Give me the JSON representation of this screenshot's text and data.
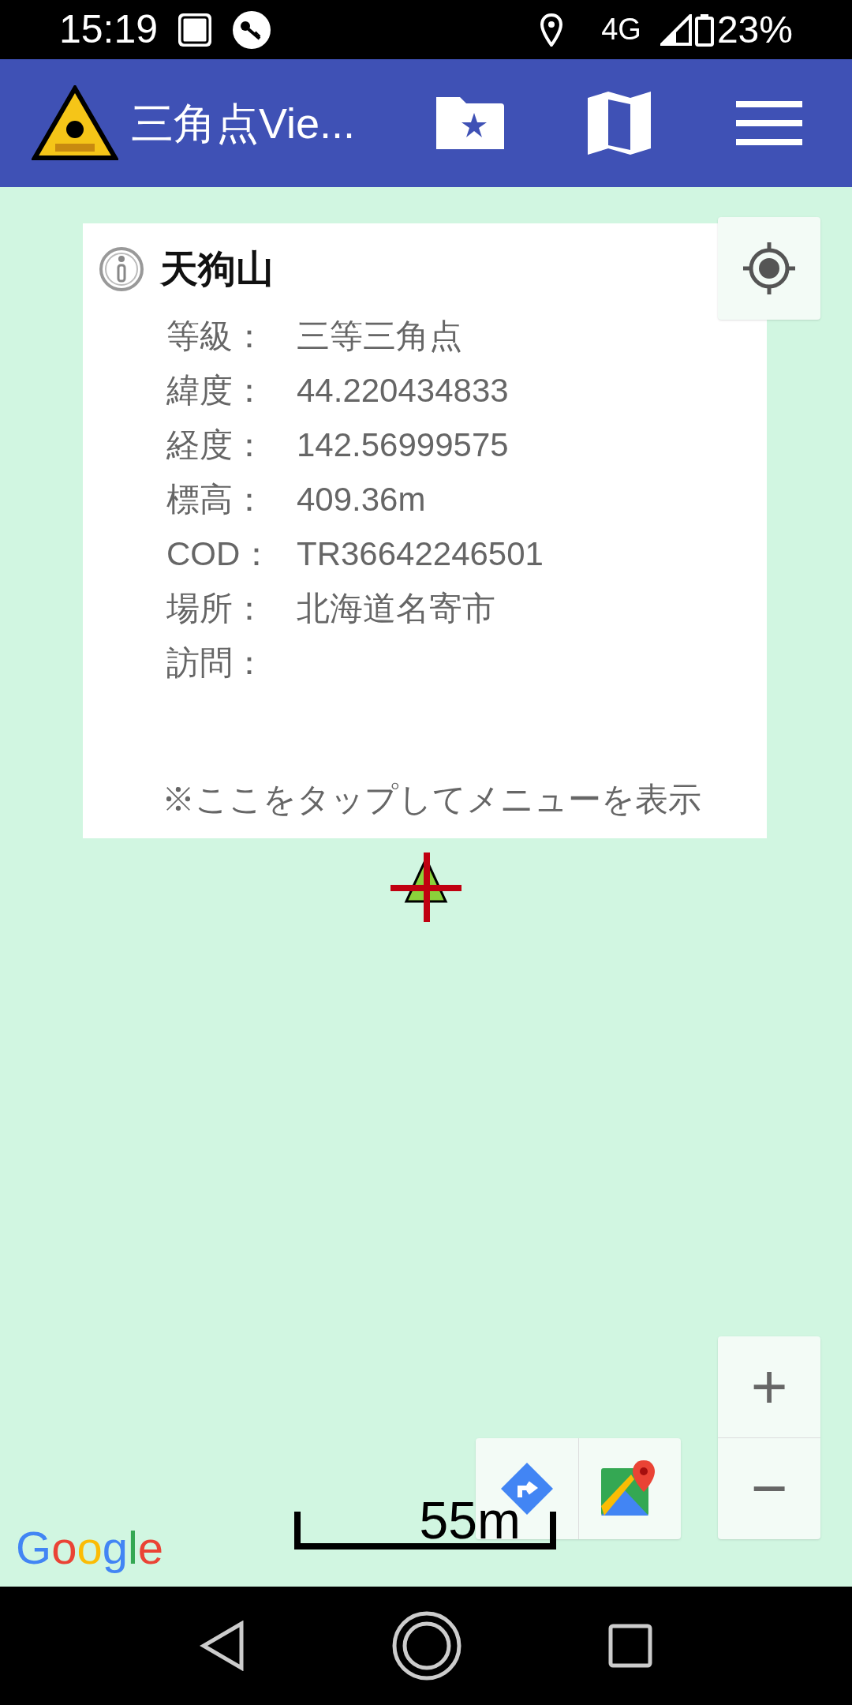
{
  "status_bar": {
    "time": "15:19",
    "network": "4G",
    "battery": "23%"
  },
  "app_bar": {
    "title": "三角点Vie..."
  },
  "info_card": {
    "title": "天狗山",
    "rows": [
      {
        "label": "等級：",
        "value": "三等三角点"
      },
      {
        "label": "緯度：",
        "value": "44.220434833"
      },
      {
        "label": "経度：",
        "value": "142.56999575"
      },
      {
        "label": "標高：",
        "value": "409.36m"
      },
      {
        "label": "COD：",
        "value": "TR36642246501"
      },
      {
        "label": "場所：",
        "value": "北海道名寄市"
      },
      {
        "label": "訪問：",
        "value": ""
      }
    ],
    "hint": "※ここをタップしてメニューを表示"
  },
  "map": {
    "scale": "55m",
    "logo": "Google",
    "zoom_in": "+",
    "zoom_out": "−"
  }
}
